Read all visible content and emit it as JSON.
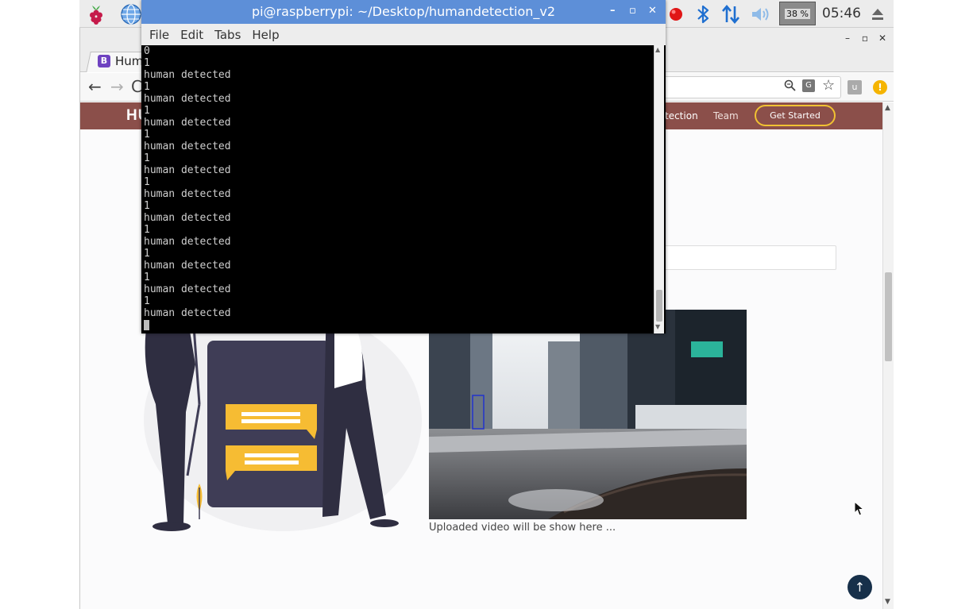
{
  "desktop_panel": {
    "cpu_usage": "38 %",
    "clock": "05:46",
    "icons": [
      "raspberry-pi-menu-icon",
      "globe-icon",
      "red-dot-icon",
      "bluetooth-icon",
      "network-icon",
      "volume-icon",
      "eject-icon"
    ]
  },
  "browser": {
    "tab": {
      "favicon": "B",
      "title": "Hum"
    },
    "window_controls": {
      "minimize": "–",
      "maximize": "▫",
      "close": "✕"
    },
    "toolbar": {
      "back": "←",
      "forward": "→",
      "reload": "C"
    },
    "extensions": {
      "u": "u",
      "alert": "!"
    }
  },
  "site": {
    "logo": "HU",
    "nav": {
      "detection": "tection",
      "team": "Team",
      "cta": "Get Started"
    },
    "video_caption": "Uploaded video will be show here ...",
    "back_to_top": "↑",
    "colors": {
      "nav_bg": "#8b4f4a",
      "cta_border": "#f1c232",
      "back_to_top_bg": "#17304a"
    }
  },
  "terminal": {
    "title": "pi@raspberrypi: ~/Desktop/humandetection_v2",
    "window_controls": {
      "minimize": "–",
      "maximize": "▫",
      "close": "✕"
    },
    "menu": [
      "File",
      "Edit",
      "Tabs",
      "Help"
    ],
    "lines": [
      "0",
      "1",
      "human detected",
      "1",
      "human detected",
      "1",
      "human detected",
      "1",
      "human detected",
      "1",
      "human detected",
      "1",
      "human detected",
      "1",
      "human detected",
      "1",
      "human detected",
      "1",
      "human detected",
      "1",
      "human detected",
      "1",
      "human detected"
    ],
    "colors": {
      "titlebar": "#5d8fd8",
      "background": "#000000",
      "text": "#cfcfcf"
    }
  }
}
